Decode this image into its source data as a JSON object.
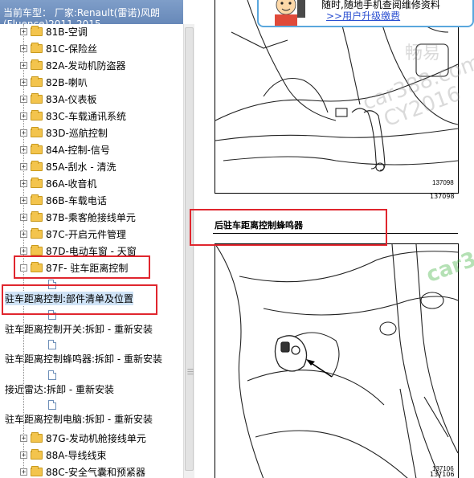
{
  "title": {
    "line1": "当前车型：  厂家:Renault(雷诺)风朗",
    "line2": "(Fluence)2011-2015"
  },
  "tree": {
    "items": [
      {
        "label": "81B-空调",
        "expander": "+"
      },
      {
        "label": "81C-保险丝",
        "expander": "+"
      },
      {
        "label": "82A-发动机防盗器",
        "expander": "+"
      },
      {
        "label": "82B-喇叭",
        "expander": "+"
      },
      {
        "label": "83A-仪表板",
        "expander": "+"
      },
      {
        "label": "83C-车载通讯系统",
        "expander": "+"
      },
      {
        "label": "83D-巡航控制",
        "expander": "+"
      },
      {
        "label": "84A-控制-信号",
        "expander": "+"
      },
      {
        "label": "85A-刮水 - 清洗",
        "expander": "+"
      },
      {
        "label": "86A-收音机",
        "expander": "+"
      },
      {
        "label": "86B-车载电话",
        "expander": "+"
      },
      {
        "label": "87B-乘客舱接线单元",
        "expander": "+"
      },
      {
        "label": "87C-开启元件管理",
        "expander": "+"
      },
      {
        "label": "87D-电动车窗 - 天窗",
        "expander": "+"
      },
      {
        "label": "87F- 驻车距离控制",
        "expander": "-"
      }
    ],
    "children": [
      {
        "label": "驻车距离控制:部件清单及位置",
        "selected": true
      },
      {
        "label": "驻车距离控制开关:拆卸 - 重新安装",
        "selected": false
      },
      {
        "label": "驻车距离控制蜂鸣器:拆卸 - 重新安装",
        "selected": false
      },
      {
        "label": "接近雷达:拆卸 - 重新安装",
        "selected": false
      },
      {
        "label": "驻车距离控制电脑:拆卸 - 重新安装",
        "selected": false
      }
    ],
    "after": [
      {
        "label": "87G-发动机舱接线单元",
        "expander": "+"
      },
      {
        "label": "88A-导线线束",
        "expander": "+"
      },
      {
        "label": "88C-安全气囊和预紧器",
        "expander": "+"
      }
    ]
  },
  "content": {
    "section_title": "后驻车距离控制蜂鸣器",
    "fig1_num_a": "137098",
    "fig1_num_b": "137098",
    "fig2_num_a": "137106",
    "fig2_num_b": "137106"
  },
  "banner": {
    "line1": "随时,随地手机查阅维修资料",
    "link": ">>用户升级缴费"
  },
  "watermark": {
    "brand": "畅易",
    "site": "car388.com",
    "code": "CY2016",
    "site2": "car3"
  },
  "colors": {
    "highlight_box": "#e0262e",
    "selection": "#cfe3f7",
    "folder": "#f3c44d",
    "search_button": "#ec5a48"
  }
}
